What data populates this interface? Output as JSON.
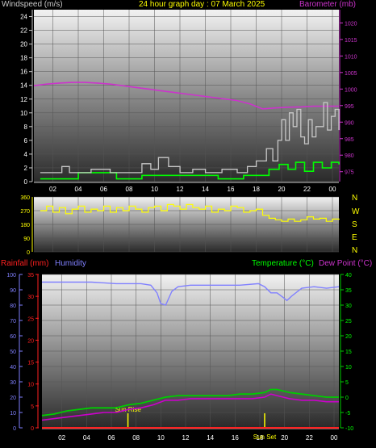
{
  "header": {
    "windspeed_label": "Windspeed (m/s)",
    "title": "24 hour graph day : 07 March 2025",
    "barometer_label": "Barometer (mb)"
  },
  "compass": [
    "N",
    "W",
    "S",
    "E",
    "N"
  ],
  "bottom_header": {
    "rainfall_label": "Rainfall (mm)",
    "humidity_label": "Humidity",
    "temperature_label": "Temperature (°C)",
    "dewpoint_label": "Dew Point (°C)"
  },
  "colors": {
    "windspeed": "#c8c8c8",
    "windspeed_avg": "#00ff00",
    "barometer": "#cc33cc",
    "direction": "#ffff00",
    "rainfall": "#ff2020",
    "humidity": "#8080ff",
    "temperature": "#00cc00",
    "dewpoint": "#cc00cc",
    "sun": "#ffff00"
  },
  "chart_data": [
    {
      "type": "line",
      "x_ticks": [
        "02",
        "04",
        "06",
        "08",
        "10",
        "12",
        "14",
        "16",
        "18",
        "20",
        "22",
        "00"
      ],
      "y_axis": {
        "ylim": [
          0,
          25
        ],
        "ticks": [
          0,
          2,
          4,
          6,
          8,
          10,
          12,
          14,
          16,
          18,
          20,
          22,
          24
        ]
      },
      "y2_axis": {
        "ylim": [
          972,
          1024
        ],
        "ticks": [
          975,
          980,
          985,
          990,
          995,
          1000,
          1005,
          1010,
          1015,
          1020
        ]
      },
      "series": [
        {
          "name": "Windspeed (m/s)",
          "axis": "left",
          "x": [
            0.5,
            1.5,
            2.2,
            2.8,
            3.5,
            4.5,
            6,
            7.5,
            8.5,
            9.2,
            9.8,
            10.6,
            11.5,
            12.5,
            13.5,
            14.8,
            16,
            16.8,
            17.5,
            18.0,
            18.3,
            18.8,
            19.2,
            19.5,
            19.8,
            20.1,
            20.4,
            20.7,
            21.0,
            21.3,
            21.6,
            21.9,
            22.2,
            22.5,
            22.8,
            23.1,
            23.4,
            23.7,
            24.0
          ],
          "values": [
            1.3,
            1.3,
            2.2,
            1.3,
            1.3,
            1.8,
            1.3,
            1.3,
            2.6,
            1.8,
            3.5,
            2.2,
            1.3,
            1.8,
            1.3,
            1.8,
            1.3,
            2.2,
            3.0,
            3.0,
            4.8,
            3.0,
            6.0,
            9.0,
            6.0,
            10.0,
            8.0,
            10.5,
            6.5,
            5.5,
            9.0,
            6.5,
            8.0,
            8.0,
            11.5,
            7.5,
            9.5,
            10.5,
            7.5
          ]
        },
        {
          "name": "Windspeed average",
          "axis": "left",
          "x": [
            0.5,
            2.5,
            3.5,
            6.5,
            8.5,
            10.5,
            12.5,
            14.5,
            16.5,
            17.5,
            18.5,
            19.3,
            20.0,
            20.6,
            21.3,
            22.0,
            22.7,
            23.4,
            24.0
          ],
          "values": [
            0.4,
            0.4,
            1.3,
            0.4,
            0.9,
            0.9,
            0.9,
            0.4,
            0.9,
            0.9,
            1.8,
            2.5,
            1.8,
            2.8,
            1.5,
            2.8,
            2.0,
            2.8,
            2.5
          ]
        },
        {
          "name": "Barometer (mb)",
          "axis": "right",
          "x": [
            0,
            1,
            2,
            3,
            4,
            5,
            6,
            7,
            8,
            9,
            10,
            11,
            12,
            13,
            14,
            15,
            16,
            17,
            18,
            19,
            20,
            21,
            22,
            23,
            24
          ],
          "values": [
            1001.0,
            1001.5,
            1001.8,
            1002.0,
            1002.0,
            1001.8,
            1001.5,
            1001.0,
            1000.5,
            1000.0,
            999.5,
            999.0,
            998.5,
            998.0,
            997.5,
            997.0,
            996.5,
            995.5,
            994.0,
            994.3,
            994.5,
            994.6,
            994.8,
            994.8,
            994.8
          ]
        }
      ]
    },
    {
      "type": "line",
      "x_ticks": [
        "02",
        "04",
        "06",
        "08",
        "10",
        "12",
        "14",
        "16",
        "18",
        "20",
        "22",
        "00"
      ],
      "y_axis": {
        "ylim": [
          0,
          360
        ],
        "ticks": [
          0,
          90,
          180,
          270,
          360
        ]
      },
      "series": [
        {
          "name": "Wind direction",
          "x": [
            0.5,
            1.0,
            1.5,
            2.0,
            2.5,
            3.0,
            3.5,
            4.0,
            4.5,
            5.0,
            5.5,
            6.0,
            6.5,
            7.0,
            7.5,
            8.0,
            8.5,
            9.0,
            9.5,
            10.0,
            10.5,
            11.0,
            11.5,
            12.0,
            12.5,
            13.0,
            13.5,
            14.0,
            14.5,
            15.0,
            15.5,
            16.0,
            16.5,
            17.0,
            17.5,
            18.0,
            18.5,
            19.0,
            19.5,
            20.0,
            20.5,
            21.0,
            21.5,
            22.0,
            22.5,
            23.0,
            23.5,
            24.0
          ],
          "values": [
            270,
            300,
            260,
            290,
            250,
            280,
            300,
            260,
            280,
            270,
            300,
            260,
            290,
            270,
            300,
            280,
            260,
            290,
            300,
            270,
            310,
            300,
            280,
            310,
            290,
            280,
            300,
            260,
            280,
            270,
            300,
            290,
            260,
            270,
            280,
            240,
            220,
            210,
            200,
            215,
            200,
            210,
            230,
            215,
            220,
            200,
            215,
            210
          ]
        }
      ]
    },
    {
      "type": "line",
      "x_ticks": [
        "02",
        "04",
        "06",
        "08",
        "10",
        "12",
        "14",
        "16",
        "18",
        "20",
        "22",
        "00"
      ],
      "y_axis_rain": {
        "ylim": [
          0,
          35
        ],
        "ticks": [
          0,
          5,
          10,
          15,
          20,
          25,
          30,
          35
        ]
      },
      "y_axis_humidity": {
        "ylim": [
          0,
          100
        ],
        "ticks": [
          0,
          10,
          20,
          30,
          40,
          50,
          60,
          70,
          80,
          90,
          100
        ]
      },
      "y2_axis": {
        "ylim": [
          -10,
          40
        ],
        "ticks": [
          -10,
          -5,
          0,
          5,
          10,
          15,
          20,
          25,
          30,
          35,
          40
        ]
      },
      "annotations": [
        {
          "label": "Sun Rise",
          "x": 6.95
        },
        {
          "label": "Sun Set",
          "x": 18.0
        }
      ],
      "series": [
        {
          "name": "Rainfall (mm)",
          "axis": "rain",
          "x": [
            0,
            24
          ],
          "values": [
            0,
            0
          ]
        },
        {
          "name": "Humidity",
          "axis": "humidity",
          "x": [
            0,
            2,
            4,
            6,
            8,
            8.8,
            9.3,
            9.6,
            10.0,
            10.5,
            11.0,
            12,
            14,
            16,
            17.5,
            18.0,
            18.5,
            19.0,
            19.5,
            19.8,
            20.2,
            21,
            22,
            23,
            24
          ],
          "values": [
            95,
            95,
            95,
            94,
            94,
            93,
            88,
            81,
            80,
            89,
            92,
            93,
            93,
            93,
            94,
            92,
            88,
            88,
            85,
            83,
            86,
            91,
            92,
            91,
            92
          ]
        },
        {
          "name": "Temperature (°C)",
          "axis": "right",
          "x": [
            0,
            1,
            2,
            3,
            4,
            5,
            6,
            7,
            8,
            9,
            10,
            11,
            12,
            13,
            14,
            15,
            16,
            17,
            18,
            18.5,
            19,
            19.5,
            20,
            21,
            22,
            23,
            24
          ],
          "values": [
            -6,
            -5.5,
            -4.5,
            -4,
            -3.5,
            -3.5,
            -3.5,
            -2.5,
            -2,
            -1,
            0,
            0.5,
            0.5,
            0.5,
            0.5,
            0.5,
            1,
            1,
            1.5,
            2.5,
            2.5,
            2.0,
            1.5,
            1,
            0.5,
            0,
            0
          ]
        },
        {
          "name": "Dew Point (°C)",
          "axis": "right",
          "x": [
            0,
            1,
            2,
            3,
            4,
            5,
            6,
            7,
            8,
            9,
            10,
            11,
            12,
            13,
            14,
            15,
            16,
            17,
            18,
            18.5,
            19,
            19.5,
            20,
            21,
            22,
            23,
            24
          ],
          "values": [
            -7.5,
            -7,
            -6.5,
            -6,
            -5.5,
            -5,
            -5,
            -4,
            -3.5,
            -2.5,
            -1,
            -1,
            -0.5,
            -0.5,
            -0.5,
            -0.5,
            -0.5,
            -0.5,
            0,
            1,
            0.5,
            0,
            -0.5,
            -1,
            -1,
            -1.5,
            -1.5
          ]
        }
      ]
    }
  ]
}
